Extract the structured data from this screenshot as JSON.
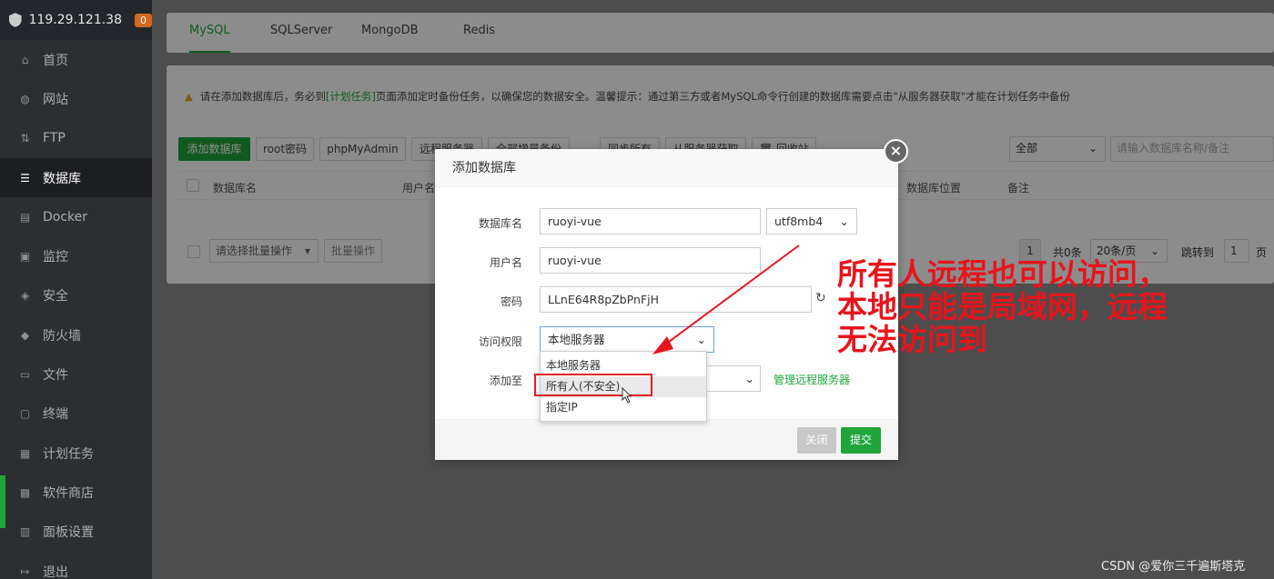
{
  "sidebar": {
    "server_ip": "119.29.121.38",
    "badge": "0",
    "items": [
      {
        "label": "首页",
        "icon": "home-icon"
      },
      {
        "label": "网站",
        "icon": "globe-icon"
      },
      {
        "label": "FTP",
        "icon": "ftp-icon"
      },
      {
        "label": "数据库",
        "icon": "database-icon",
        "active": true
      },
      {
        "label": "Docker",
        "icon": "docker-icon"
      },
      {
        "label": "监控",
        "icon": "monitor-icon"
      },
      {
        "label": "安全",
        "icon": "shield-check-icon"
      },
      {
        "label": "防火墙",
        "icon": "firewall-icon"
      },
      {
        "label": "文件",
        "icon": "folder-icon"
      },
      {
        "label": "终端",
        "icon": "terminal-icon"
      },
      {
        "label": "计划任务",
        "icon": "calendar-icon"
      },
      {
        "label": "软件商店",
        "icon": "store-icon"
      },
      {
        "label": "面板设置",
        "icon": "settings-icon"
      },
      {
        "label": "退出",
        "icon": "logout-icon"
      }
    ]
  },
  "tabs": [
    "MySQL",
    "SQLServer",
    "MongoDB",
    "Redis"
  ],
  "notice": {
    "prefix": "请在添加数据库后，务必到",
    "link": "[计划任务]",
    "suffix": "页面添加定时备份任务，以确保您的数据安全。温馨提示：通过第三方或者MySQL命令行创建的数据库需要点击\"从服务器获取\"才能在计划任务中备份"
  },
  "toolbar": {
    "add_db": "添加数据库",
    "root_pwd": "root密码",
    "phpmyadmin": "phpMyAdmin",
    "remote": "远程服务器",
    "backup": "全部增量备份",
    "sync": "同步所有",
    "fetch": "从服务器获取",
    "recycle": "回收站",
    "filter_select": "全部",
    "search_placeholder": "请输入数据库名称/备注"
  },
  "table": {
    "headers": [
      "数据库名",
      "用户名",
      "数据库位置",
      "备注"
    ]
  },
  "footer": {
    "batch_select": "请选择批量操作",
    "batch_btn": "批量操作",
    "page": "1",
    "total": "共0条",
    "per_page": "20条/页",
    "jump_label": "跳转到",
    "jump_value": "1",
    "page_unit": "页"
  },
  "dialog": {
    "title": "添加数据库",
    "db_name_label": "数据库名",
    "db_name_value": "ruoyi-vue",
    "charset": "utf8mb4",
    "user_label": "用户名",
    "user_value": "ruoyi-vue",
    "pwd_label": "密码",
    "pwd_value": "LLnE64R8pZbPnFjH",
    "access_label": "访问权限",
    "access_value": "本地服务器",
    "add_to_label": "添加至",
    "manage_remote": "管理远程服务器",
    "options": [
      "本地服务器",
      "所有人(不安全)",
      "指定IP"
    ],
    "close_btn": "关闭",
    "submit_btn": "提交"
  },
  "annotation": "所有人远程也可以访问，\n本地只能是局域网，远程\n无法访问到",
  "watermark": "CSDN @爱你三千遍斯塔克",
  "colors": {
    "accent": "#20a53a",
    "annotation": "#e8141c"
  }
}
